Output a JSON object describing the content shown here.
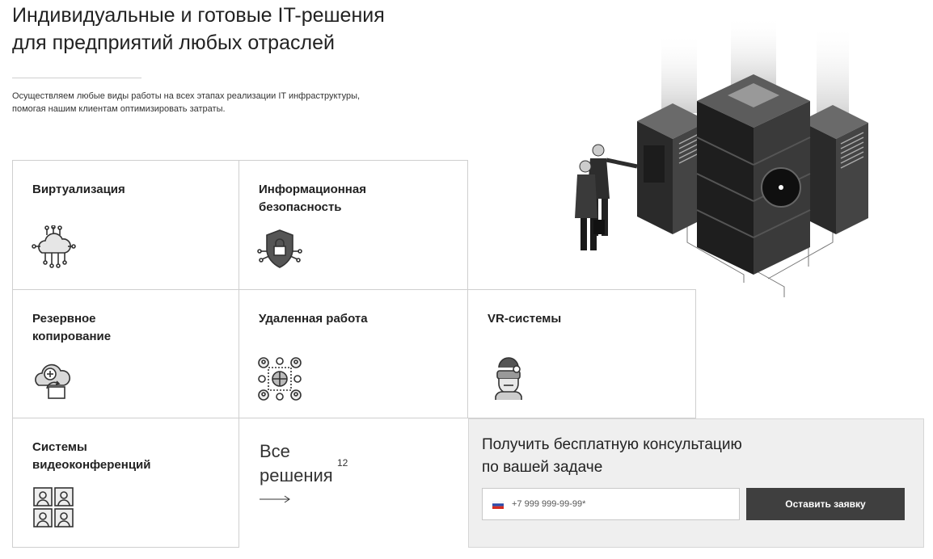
{
  "hero": {
    "title_line1": "Индивидуальные и готовые IT-решения",
    "title_line2": "для предприятий любых отраслей",
    "desc_line1": "Осуществляем любые виды работы на всех этапах реализации IT инфраструктуры,",
    "desc_line2": "помогая нашим клиентам оптимизировать затраты."
  },
  "cards": {
    "virtualization": {
      "title": "Виртуализация",
      "icon": "cloud-circuit-icon"
    },
    "security": {
      "title_line1": "Информационная",
      "title_line2": "безопасность",
      "icon": "shield-lock-icon"
    },
    "backup": {
      "title_line1": "Резервное",
      "title_line2": "копирование",
      "icon": "cloud-backup-icon"
    },
    "remote": {
      "title": "Удаленная работа",
      "icon": "globe-network-icon"
    },
    "vr": {
      "title": "VR-системы",
      "icon": "vr-headset-person-icon"
    },
    "video": {
      "title_line1": "Системы",
      "title_line2": "видеоконференций",
      "icon": "video-grid-icon"
    }
  },
  "all_solutions": {
    "line1": "Все",
    "line2": "решения",
    "count": "12",
    "arrow_icon": "long-arrow-right-icon"
  },
  "consult": {
    "title_line1": "Получить бесплатную консультацию",
    "title_line2": "по вашей задаче",
    "phone_placeholder": "+7 999 999-99-99*",
    "flag_icon": "russia-flag-icon",
    "submit_label": "Оставить заявку"
  },
  "illustration": {
    "icon": "server-isometric-illustration"
  }
}
